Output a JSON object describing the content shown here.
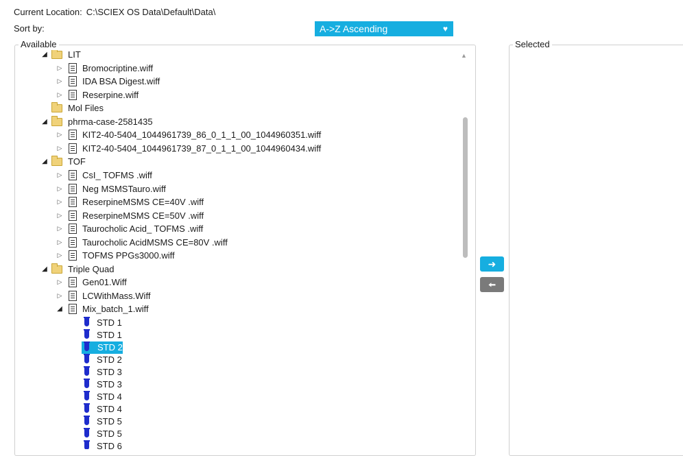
{
  "location": {
    "label": "Current Location:",
    "path": "C:\\SCIEX OS Data\\Default\\Data\\"
  },
  "sort": {
    "label": "Sort by:",
    "value": "A->Z Ascending"
  },
  "available_title": "Available",
  "selected_title": "Selected",
  "tree": [
    {
      "level": 1,
      "type": "folder",
      "label": "LIT",
      "expanded": true
    },
    {
      "level": 2,
      "type": "file",
      "label": "Bromocriptine.wiff",
      "expanded": false
    },
    {
      "level": 2,
      "type": "file",
      "label": "IDA BSA Digest.wiff",
      "expanded": false
    },
    {
      "level": 2,
      "type": "file",
      "label": "Reserpine.wiff",
      "expanded": false
    },
    {
      "level": 1,
      "type": "folder",
      "label": "Mol Files",
      "expanded": null
    },
    {
      "level": 1,
      "type": "folder",
      "label": "phrma-case-2581435",
      "expanded": true
    },
    {
      "level": 2,
      "type": "file",
      "label": "KIT2-40-5404_1044961739_86_0_1_1_00_1044960351.wiff",
      "expanded": false
    },
    {
      "level": 2,
      "type": "file",
      "label": "KIT2-40-5404_1044961739_87_0_1_1_00_1044960434.wiff",
      "expanded": false
    },
    {
      "level": 1,
      "type": "folder",
      "label": "TOF",
      "expanded": true
    },
    {
      "level": 2,
      "type": "file",
      "label": "CsI_ TOFMS  .wiff",
      "expanded": false
    },
    {
      "level": 2,
      "type": "file",
      "label": "Neg MSMSTauro.wiff",
      "expanded": false
    },
    {
      "level": 2,
      "type": "file",
      "label": "ReserpineMSMS CE=40V .wiff",
      "expanded": false
    },
    {
      "level": 2,
      "type": "file",
      "label": "ReserpineMSMS CE=50V .wiff",
      "expanded": false
    },
    {
      "level": 2,
      "type": "file",
      "label": "Taurocholic Acid_ TOFMS  .wiff",
      "expanded": false
    },
    {
      "level": 2,
      "type": "file",
      "label": "Taurocholic AcidMSMS CE=80V .wiff",
      "expanded": false
    },
    {
      "level": 2,
      "type": "file",
      "label": "TOFMS PPGs3000.wiff",
      "expanded": false
    },
    {
      "level": 1,
      "type": "folder",
      "label": "Triple Quad",
      "expanded": true
    },
    {
      "level": 2,
      "type": "file",
      "label": "Gen01.Wiff",
      "expanded": false
    },
    {
      "level": 2,
      "type": "file",
      "label": "LCWithMass.Wiff",
      "expanded": false
    },
    {
      "level": 2,
      "type": "file",
      "label": "Mix_batch_1.wiff",
      "expanded": true
    },
    {
      "level": 3,
      "type": "sample",
      "label": "STD 1",
      "selected": false
    },
    {
      "level": 3,
      "type": "sample",
      "label": "STD 1",
      "selected": false
    },
    {
      "level": 3,
      "type": "sample",
      "label": "STD 2",
      "selected": true
    },
    {
      "level": 3,
      "type": "sample",
      "label": "STD 2",
      "selected": false
    },
    {
      "level": 3,
      "type": "sample",
      "label": "STD 3",
      "selected": false
    },
    {
      "level": 3,
      "type": "sample",
      "label": "STD 3",
      "selected": false
    },
    {
      "level": 3,
      "type": "sample",
      "label": "STD 4",
      "selected": false
    },
    {
      "level": 3,
      "type": "sample",
      "label": "STD 4",
      "selected": false
    },
    {
      "level": 3,
      "type": "sample",
      "label": "STD 5",
      "selected": false
    },
    {
      "level": 3,
      "type": "sample",
      "label": "STD 5",
      "selected": false
    },
    {
      "level": 3,
      "type": "sample",
      "label": "STD 6",
      "selected": false
    }
  ],
  "buttons": {
    "add_icon": "arrow-right-icon",
    "remove_icon": "arrow-left-icon"
  },
  "colors": {
    "accent": "#16aee0",
    "remove_button": "#7a7a7a",
    "vial": "#1e2ccc"
  }
}
